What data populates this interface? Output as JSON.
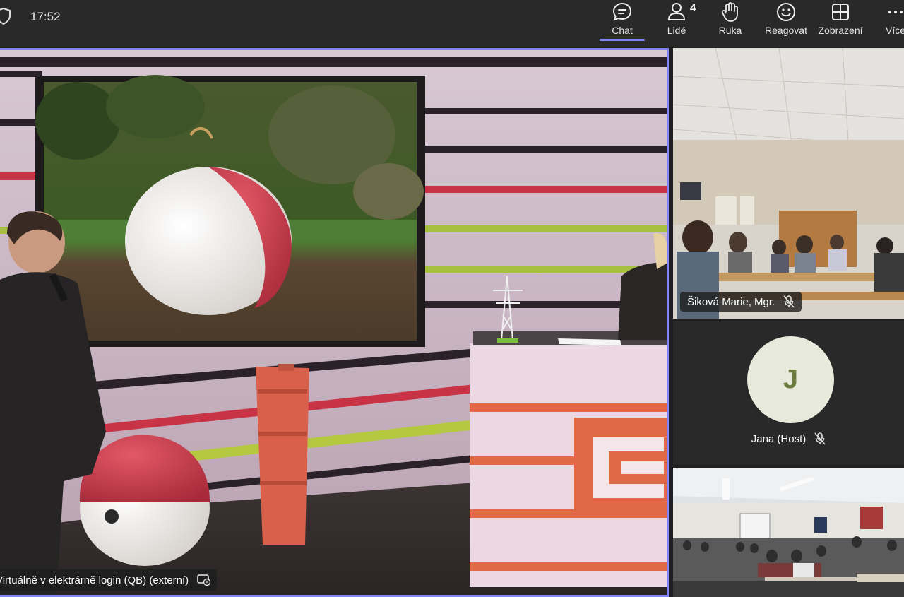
{
  "header": {
    "time": "17:52",
    "chat_label": "Chat",
    "people_label": "Lidé",
    "people_count": "4",
    "hand_label": "Ruka",
    "react_label": "Reagovat",
    "view_label": "Zobrazení",
    "more_label": "Více"
  },
  "stage": {
    "presenter_name": "Virtuálně v elektrárně login (QB) (externí)"
  },
  "participants": [
    {
      "name": "Šiková Marie, Mgr.",
      "muted": true
    },
    {
      "name": "Jana (Host)",
      "initial": "J",
      "muted": true
    },
    {
      "name": "",
      "muted": false
    }
  ],
  "colors": {
    "accent": "#7f85f5",
    "topbar": "#292929",
    "brand_orange": "#e06a48",
    "ball_red": "#c8354a"
  }
}
